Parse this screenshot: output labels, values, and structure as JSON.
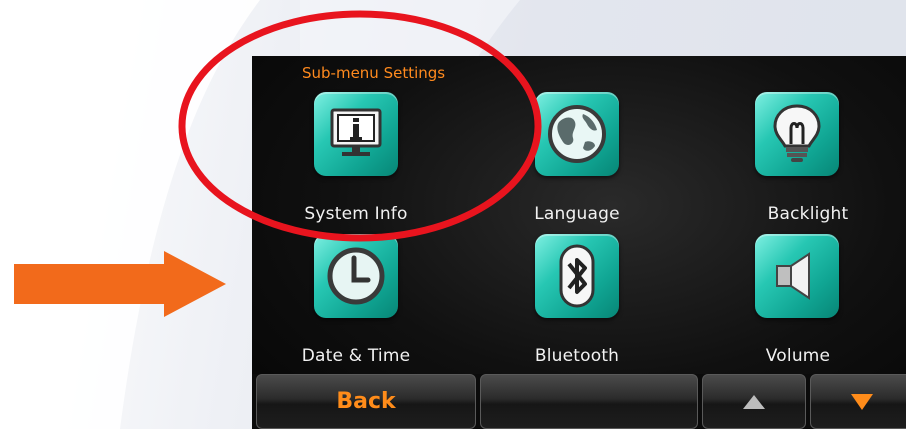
{
  "screen": {
    "title": "Sub-menu Settings"
  },
  "menu": {
    "items": [
      {
        "label": "System Info",
        "icon": "info-monitor-icon"
      },
      {
        "label": "Language",
        "icon": "globe-icon"
      },
      {
        "label": "Backlight",
        "icon": "lightbulb-icon"
      },
      {
        "label": "Date & Time",
        "icon": "clock-icon"
      },
      {
        "label": "Bluetooth",
        "icon": "bluetooth-icon"
      },
      {
        "label": "Volume",
        "icon": "speaker-icon"
      }
    ]
  },
  "bottom_bar": {
    "back_label": "Back",
    "up_icon": "up-arrow-icon",
    "down_icon": "down-arrow-icon"
  },
  "annotations": {
    "highlight_color": "#e8141e",
    "arrow_color": "#f26a1b"
  },
  "colors": {
    "accent": "#ff8a1e",
    "tile": "#1bb8a5"
  }
}
